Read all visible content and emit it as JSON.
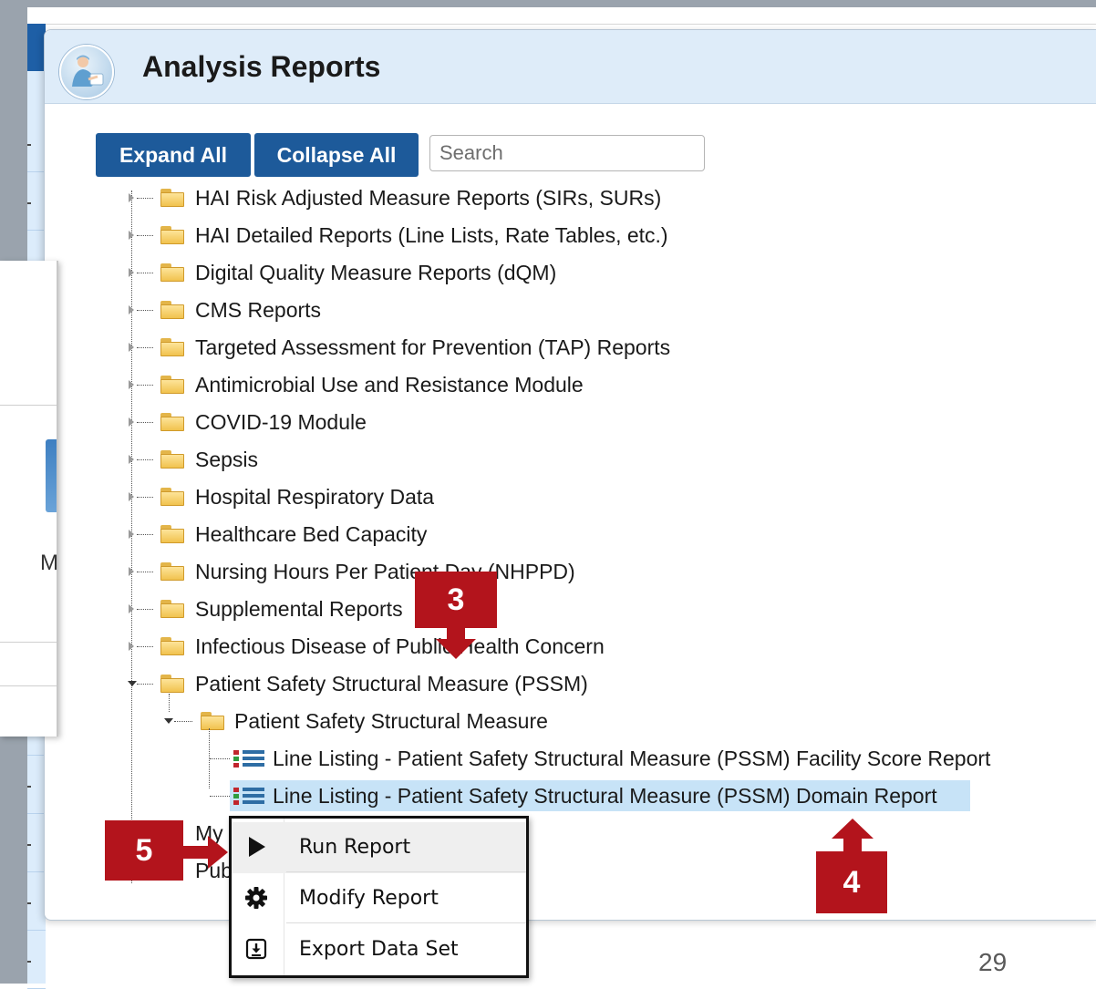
{
  "window": {
    "title": "Analysis Reports"
  },
  "toolbar": {
    "expand_all_label": "Expand All",
    "collapse_all_label": "Collapse All",
    "search_placeholder": "Search"
  },
  "tree": {
    "folders": [
      "HAI Risk Adjusted Measure Reports (SIRs, SURs)",
      "HAI Detailed Reports (Line Lists, Rate Tables, etc.)",
      "Digital Quality Measure Reports (dQM)",
      "CMS Reports",
      "Targeted Assessment for Prevention (TAP) Reports",
      "Antimicrobial Use and Resistance Module",
      "COVID-19 Module",
      "Sepsis",
      "Hospital Respiratory Data",
      "Healthcare Bed Capacity",
      "Nursing Hours Per Patient Day (NHPPD)",
      "Supplemental Reports",
      "Infectious Disease of Public Health Concern",
      "Patient Safety Structural Measure (PSSM)"
    ],
    "subfolder": "Patient Safety Structural Measure",
    "reports": [
      "Line Listing - Patient Safety Structural Measure (PSSM) Facility Score Report",
      "Line Listing - Patient Safety Structural Measure (PSSM) Domain Report"
    ],
    "partial_items": [
      "My",
      "Pub"
    ]
  },
  "context_menu": {
    "items": [
      {
        "label": "Run Report",
        "icon": "play-icon"
      },
      {
        "label": "Modify Report",
        "icon": "gear-icon"
      },
      {
        "label": "Export Data Set",
        "icon": "export-icon"
      }
    ]
  },
  "callouts": {
    "step3": "3",
    "step4": "4",
    "step5": "5"
  },
  "background_panel": {
    "partial_letter": "M"
  },
  "slide": {
    "page_number": "29"
  },
  "colors": {
    "button_blue": "#1d5a9a",
    "header_bg": "#deecf9",
    "selection": "#c7e3f7",
    "callout_red": "#b3141c",
    "folder_yellow": "#f1c24e"
  }
}
